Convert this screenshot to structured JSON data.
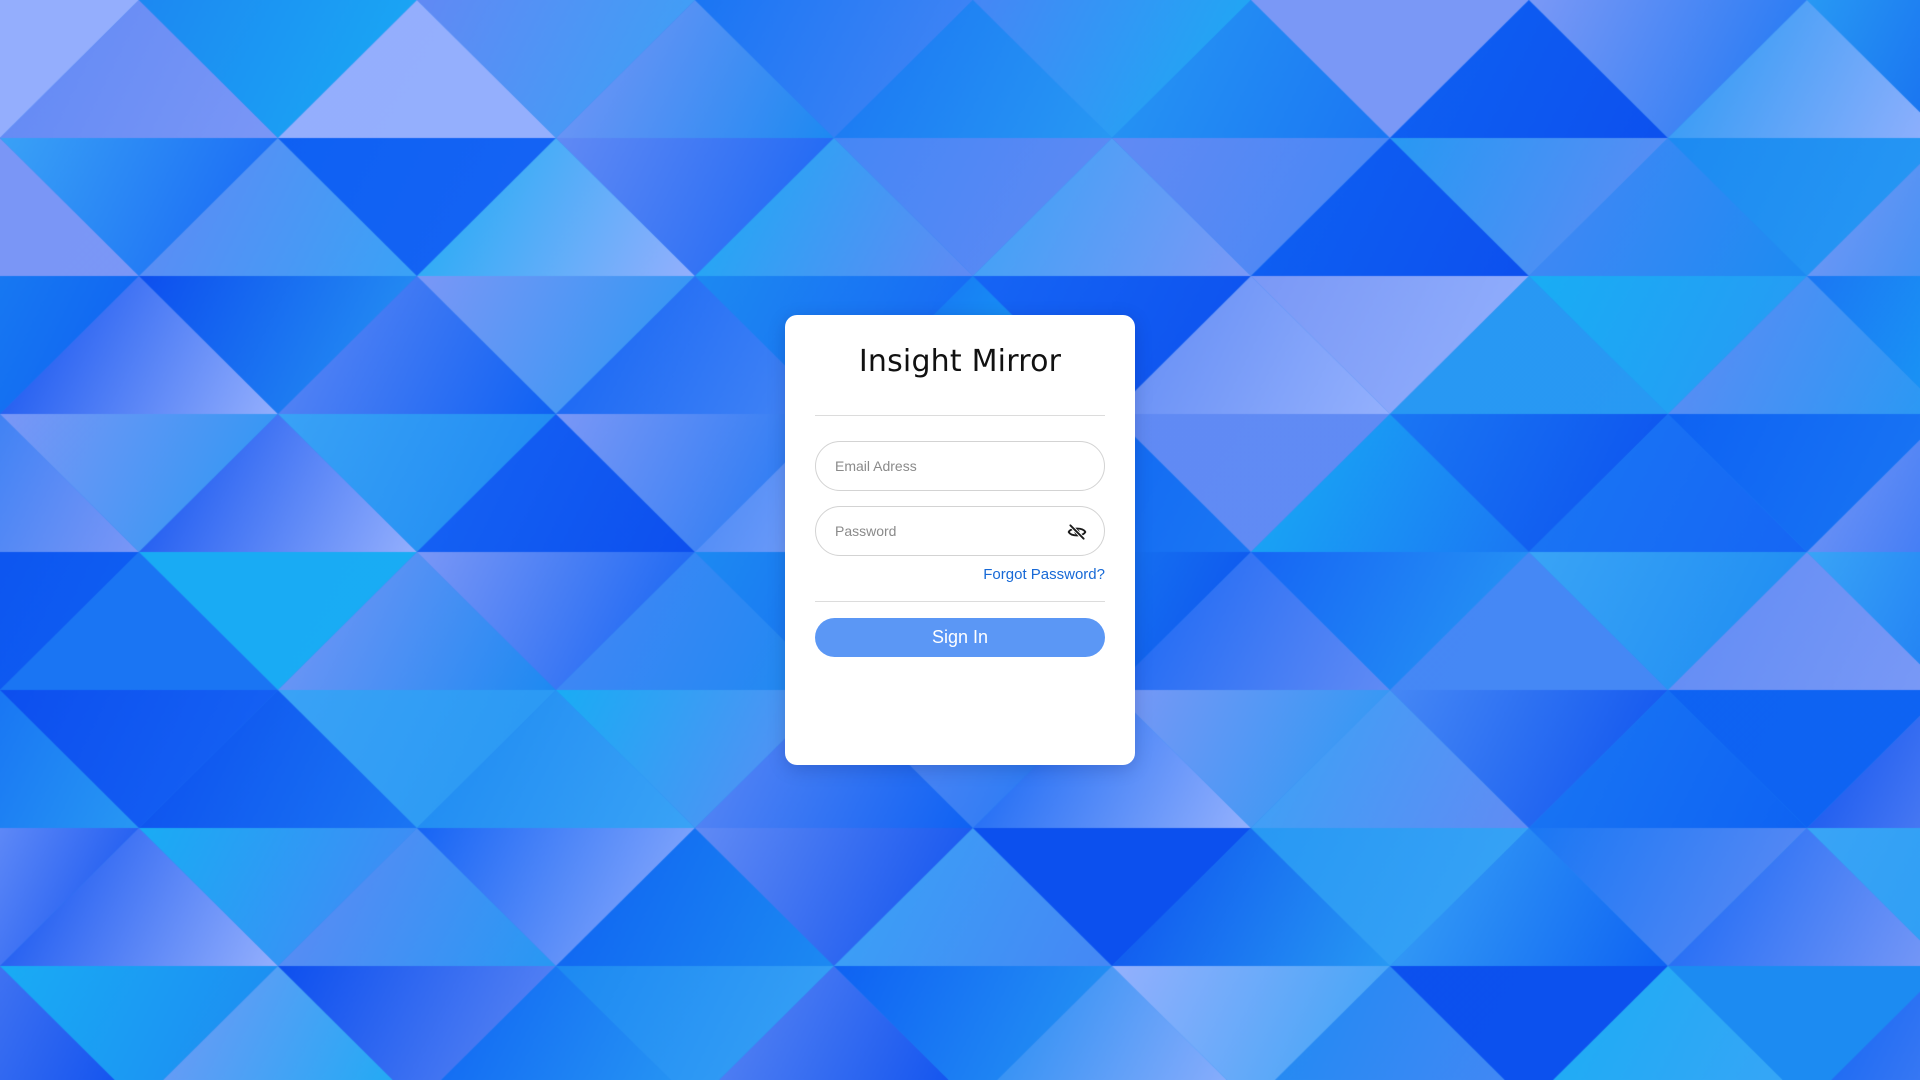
{
  "login": {
    "title": "Insight Mirror",
    "email_placeholder": "Email Adress",
    "password_placeholder": "Password",
    "forgot_password_label": "Forgot Password?",
    "sign_in_label": "Sign In"
  },
  "icons": {
    "password_toggle": "eye-off-icon"
  },
  "colors": {
    "sign_in_button": "#5b97f5",
    "forgot_link": "#1769d6",
    "card_background": "#ffffff",
    "background_light": "#a9b8ff",
    "background_mid": "#1d8bf2",
    "background_dark": "#0a47ee"
  }
}
